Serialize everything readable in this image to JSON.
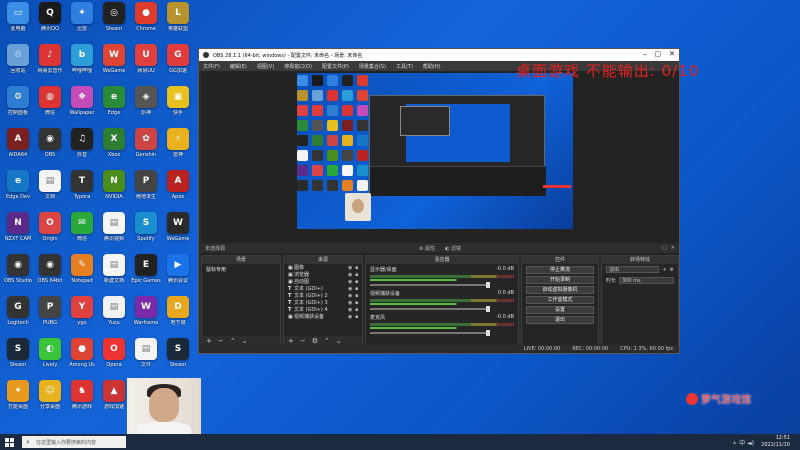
{
  "desktop_icons": [
    {
      "label": "此电脑",
      "color": "#3a8ee6",
      "glyph": "▭"
    },
    {
      "label": "腾讯QQ",
      "color": "#1a1a1a",
      "glyph": "Q"
    },
    {
      "label": "迅雷",
      "color": "#2f7fe0",
      "glyph": "✦"
    },
    {
      "label": "Steam",
      "color": "#222",
      "glyph": "◎"
    },
    {
      "label": "Chrome",
      "color": "#dd3b2b",
      "glyph": "●"
    },
    {
      "label": "英雄联盟",
      "color": "#b8922c",
      "glyph": "L"
    },
    {
      "label": "回收站",
      "color": "#6aa0d8",
      "glyph": "♲"
    },
    {
      "label": "网易云音乐",
      "color": "#d33",
      "glyph": "♪"
    },
    {
      "label": "哔哩哔哩",
      "color": "#2d9fd8",
      "glyph": "b"
    },
    {
      "label": "WeGame",
      "color": "#d43",
      "glyph": "W"
    },
    {
      "label": "网易UU",
      "color": "#e04040",
      "glyph": "U"
    },
    {
      "label": "GG加速",
      "color": "#e23b3b",
      "glyph": "G"
    },
    {
      "label": "控制面板",
      "color": "#2d7dd2",
      "glyph": "⚙"
    },
    {
      "label": "微信",
      "color": "#d33",
      "glyph": "◍"
    },
    {
      "label": "Wallpaper",
      "color": "#c44bb8",
      "glyph": "❖"
    },
    {
      "label": "Edge",
      "color": "#2a8a3a",
      "glyph": "e"
    },
    {
      "label": "原神",
      "color": "#555",
      "glyph": "◈"
    },
    {
      "label": "快手",
      "color": "#e8c11e",
      "glyph": "▣"
    },
    {
      "label": "AIDA64",
      "color": "#7a2020",
      "glyph": "A"
    },
    {
      "label": "OBS",
      "color": "#333",
      "glyph": "◉"
    },
    {
      "label": "抖音",
      "color": "#222",
      "glyph": "♫"
    },
    {
      "label": "Xbox",
      "color": "#2e7d32",
      "glyph": "X"
    },
    {
      "label": "Genshin",
      "color": "#c44",
      "glyph": "✿"
    },
    {
      "label": "雷神",
      "color": "#e8b11e",
      "glyph": "⚡"
    },
    {
      "label": "Edge Dev",
      "color": "#1677c7",
      "glyph": "e"
    },
    {
      "label": "文档",
      "color": "#f5f5f5",
      "glyph": "▤"
    },
    {
      "label": "Typora",
      "color": "#333",
      "glyph": "T"
    },
    {
      "label": "NVIDIA",
      "color": "#4a8d1a",
      "glyph": "N"
    },
    {
      "label": "绝地求生",
      "color": "#444",
      "glyph": "P"
    },
    {
      "label": "Apex",
      "color": "#b22",
      "glyph": "A"
    },
    {
      "label": "NZXT CAM",
      "color": "#5a2a8a",
      "glyph": "N"
    },
    {
      "label": "Origin",
      "color": "#d44",
      "glyph": "O"
    },
    {
      "label": "微信",
      "color": "#2aa839",
      "glyph": "✉"
    },
    {
      "label": "腾讯视频",
      "color": "#f5f5f5",
      "glyph": "▤"
    },
    {
      "label": "Spotify",
      "color": "#1a8fd0",
      "glyph": "S"
    },
    {
      "label": "WeGame",
      "color": "#2a2a2a",
      "glyph": "W"
    },
    {
      "label": "OBS Studio",
      "color": "#333",
      "glyph": "◉"
    },
    {
      "label": "OBS 64bit",
      "color": "#333",
      "glyph": "◉"
    },
    {
      "label": "Notepad",
      "color": "#e67e22",
      "glyph": "✎"
    },
    {
      "label": "新建文档",
      "color": "#f5f5f5",
      "glyph": "▤"
    },
    {
      "label": "Epic Games",
      "color": "#222",
      "glyph": "E"
    },
    {
      "label": "腾讯会议",
      "color": "#1a73e8",
      "glyph": "▶"
    },
    {
      "label": "Logitech",
      "color": "#333",
      "glyph": "G"
    },
    {
      "label": "PUBG",
      "color": "#444",
      "glyph": "P"
    },
    {
      "label": "ygo",
      "color": "#e04040",
      "glyph": "Y"
    },
    {
      "label": "Yuzu",
      "color": "#f2f2f2",
      "glyph": "▤"
    },
    {
      "label": "Warframe",
      "color": "#7a2aa8",
      "glyph": "W"
    },
    {
      "label": "地下城",
      "color": "#e8a71e",
      "glyph": "D"
    },
    {
      "label": "Steam",
      "color": "#1b2838",
      "glyph": "S"
    },
    {
      "label": "Lively",
      "color": "#3ac43a",
      "glyph": "◐"
    },
    {
      "label": "Among Us",
      "color": "#d43",
      "glyph": "●"
    },
    {
      "label": "Opera",
      "color": "#e33",
      "glyph": "O"
    },
    {
      "label": "文件",
      "color": "#f5f5f5",
      "glyph": "▤"
    },
    {
      "label": "Steam",
      "color": "#1b2838",
      "glyph": "S"
    },
    {
      "label": "万能桌面",
      "color": "#e89a1e",
      "glyph": "✦"
    },
    {
      "label": "分享桌面",
      "color": "#e8b11e",
      "glyph": "☺"
    },
    {
      "label": "腾讯游戏",
      "color": "#d33",
      "glyph": "♞"
    },
    {
      "label": "游戏加速",
      "color": "#c33",
      "glyph": "▲"
    }
  ],
  "obs": {
    "title": "OBS 28.1.1 (64-bit, windows) - 配置文件: 未命名 - 场景: 未命名",
    "menu": [
      "文件(F)",
      "编辑(E)",
      "视图(V)",
      "停靠窗口(D)",
      "配置文件(P)",
      "场景集合(S)",
      "工具(T)",
      "帮助(H)"
    ],
    "status_no_source": "未选择源",
    "midbar_props": "属性",
    "midbar_filters": "滤镜",
    "dock_titles": {
      "scenes": "场景",
      "sources": "来源",
      "mixer": "混音器",
      "controls": "控件",
      "transitions": "转场特效"
    },
    "scenes": [
      "鼠标专用"
    ],
    "sources": [
      {
        "icon": "▣",
        "name": "图像"
      },
      {
        "icon": "▣",
        "name": "浏览器"
      },
      {
        "icon": "▣",
        "name": "自动图"
      },
      {
        "icon": "T",
        "name": "文本 (GDI+)"
      },
      {
        "icon": "T",
        "name": "文本 (GDI+) 2"
      },
      {
        "icon": "T",
        "name": "文本 (GDI+) 3"
      },
      {
        "icon": "T",
        "name": "文本 (GDI+) 4"
      },
      {
        "icon": "▣",
        "name": "视频捕获设备"
      }
    ],
    "mixer": [
      {
        "name": "显示器/桌面",
        "db": "-0.0 dB"
      },
      {
        "name": "视频捕获设备",
        "db": "0.0 dB"
      },
      {
        "name": "麦克风",
        "db": "-0.0 dB"
      }
    ],
    "controls": [
      "停止推流",
      "开始录制",
      "启动虚拟摄像机",
      "工作室模式",
      "设置",
      "退出"
    ],
    "transition": {
      "type": "淡出",
      "duration_label": "时长",
      "duration_value": "300 ms"
    },
    "status": {
      "live": "LIVE: 00:00:00",
      "rec": "REC: 00:00:00",
      "cpu": "CPU: 1.3%, 60.00 fps"
    }
  },
  "overlay": {
    "red_text": "桌面游戏 不能输出: 0/10",
    "watermark": "萝气游戏馆"
  },
  "taskbar": {
    "search_placeholder": "在这里输入你要搜索的内容",
    "time": "12:51",
    "date": "2022/11/10",
    "tray": "ㅅ 中 ◄)"
  }
}
